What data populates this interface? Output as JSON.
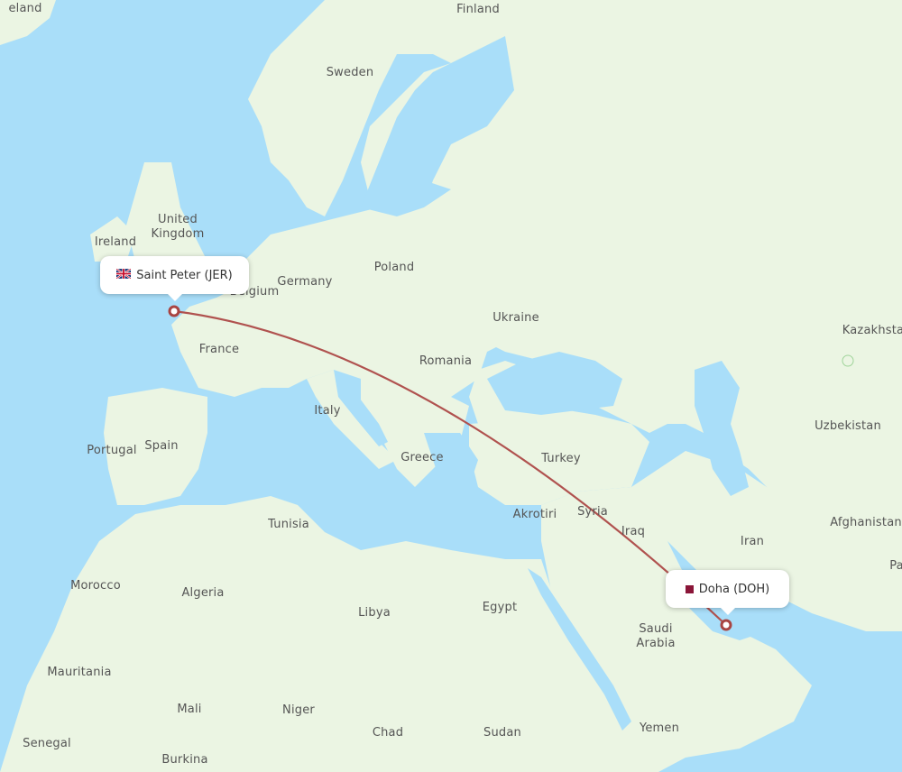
{
  "map": {
    "colors": {
      "water": "#a9def9",
      "land": "#ebf5e3",
      "border": "#9fd49a",
      "route": "#b0524f",
      "marker": "#a94442"
    },
    "country_labels": [
      {
        "name": "Iceland",
        "text": "eland"
      },
      {
        "name": "Finland",
        "text": "Finland"
      },
      {
        "name": "Sweden",
        "text": "Sweden"
      },
      {
        "name": "United Kingdom",
        "text": "United\nKingdom"
      },
      {
        "name": "Ireland",
        "text": "Ireland"
      },
      {
        "name": "Germany",
        "text": "Germany"
      },
      {
        "name": "Poland",
        "text": "Poland"
      },
      {
        "name": "Belgium",
        "text": "Belgium"
      },
      {
        "name": "Ukraine",
        "text": "Ukraine"
      },
      {
        "name": "France",
        "text": "France"
      },
      {
        "name": "Romania",
        "text": "Romania"
      },
      {
        "name": "Kazakhstan",
        "text": "Kazakhsta"
      },
      {
        "name": "Italy",
        "text": "Italy"
      },
      {
        "name": "Uzbekistan",
        "text": "Uzbekistan"
      },
      {
        "name": "Portugal",
        "text": "Portugal"
      },
      {
        "name": "Spain",
        "text": "Spain"
      },
      {
        "name": "Greece",
        "text": "Greece"
      },
      {
        "name": "Turkey",
        "text": "Turkey"
      },
      {
        "name": "Tunisia",
        "text": "Tunisia"
      },
      {
        "name": "Akrotiri",
        "text": "Akrotiri"
      },
      {
        "name": "Syria",
        "text": "Syria"
      },
      {
        "name": "Afghanistan",
        "text": "Afghanistan"
      },
      {
        "name": "Iraq",
        "text": "Iraq"
      },
      {
        "name": "Iran",
        "text": "Iran"
      },
      {
        "name": "Pakistan",
        "text": "Pa"
      },
      {
        "name": "Morocco",
        "text": "Morocco"
      },
      {
        "name": "Algeria",
        "text": "Algeria"
      },
      {
        "name": "Libya",
        "text": "Libya"
      },
      {
        "name": "Egypt",
        "text": "Egypt"
      },
      {
        "name": "Saudi Arabia",
        "text": "Saudi\nArabia"
      },
      {
        "name": "Mauritania",
        "text": "Mauritania"
      },
      {
        "name": "Mali",
        "text": "Mali"
      },
      {
        "name": "Niger",
        "text": "Niger"
      },
      {
        "name": "Chad",
        "text": "Chad"
      },
      {
        "name": "Sudan",
        "text": "Sudan"
      },
      {
        "name": "Yemen",
        "text": "Yemen"
      },
      {
        "name": "Senegal",
        "text": "Senegal"
      },
      {
        "name": "Burkina Faso",
        "text": "Burkina"
      }
    ],
    "origin": {
      "label": "Saint Peter (JER)",
      "flag": "uk-flag"
    },
    "destination": {
      "label": "Doha (DOH)",
      "flag": "qatar-flag"
    }
  }
}
